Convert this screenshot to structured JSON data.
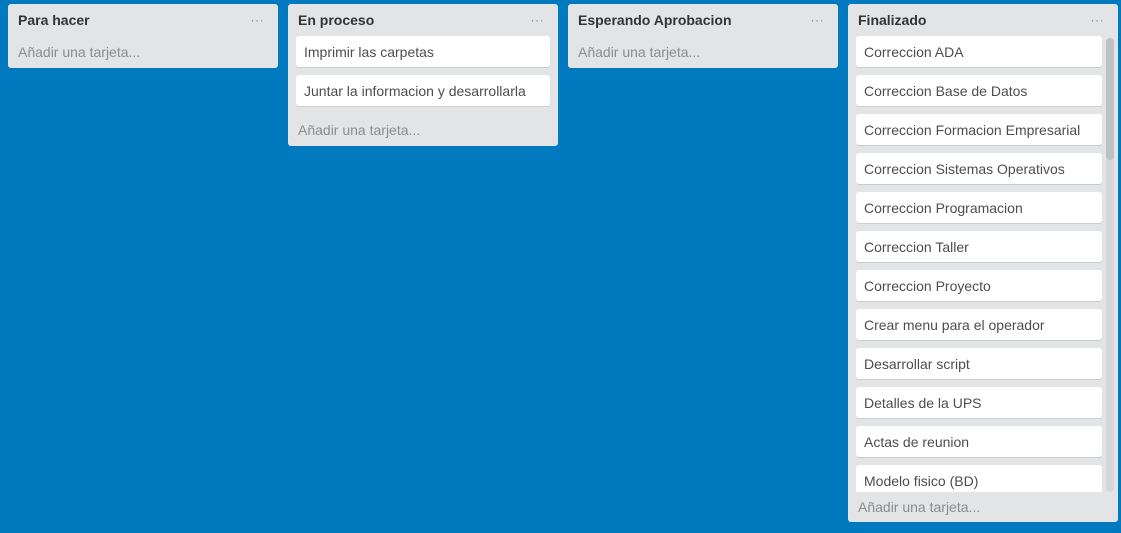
{
  "board": {
    "background_color": "#0079bf",
    "lists": [
      {
        "title": "Para hacer",
        "menu_label": "···",
        "cards": [],
        "add_label": "Añadir una tarjeta..."
      },
      {
        "title": "En proceso",
        "menu_label": "···",
        "cards": [
          "Imprimir las carpetas",
          "Juntar la informacion y desarrollarla"
        ],
        "add_label": "Añadir una tarjeta..."
      },
      {
        "title": "Esperando Aprobacion",
        "menu_label": "···",
        "cards": [],
        "add_label": "Añadir una tarjeta..."
      },
      {
        "title": "Finalizado",
        "menu_label": "···",
        "cards": [
          "Correccion ADA",
          "Correccion Base de Datos",
          "Correccion Formacion Empresarial",
          "Correccion Sistemas Operativos",
          "Correccion Programacion",
          "Correccion Taller",
          "Correccion Proyecto",
          "Crear menu para el operador",
          "Desarrollar script",
          "Detalles de la UPS",
          "Actas de reunion",
          "Modelo fisico (BD)"
        ],
        "add_label": "Añadir una tarjeta..."
      }
    ]
  }
}
